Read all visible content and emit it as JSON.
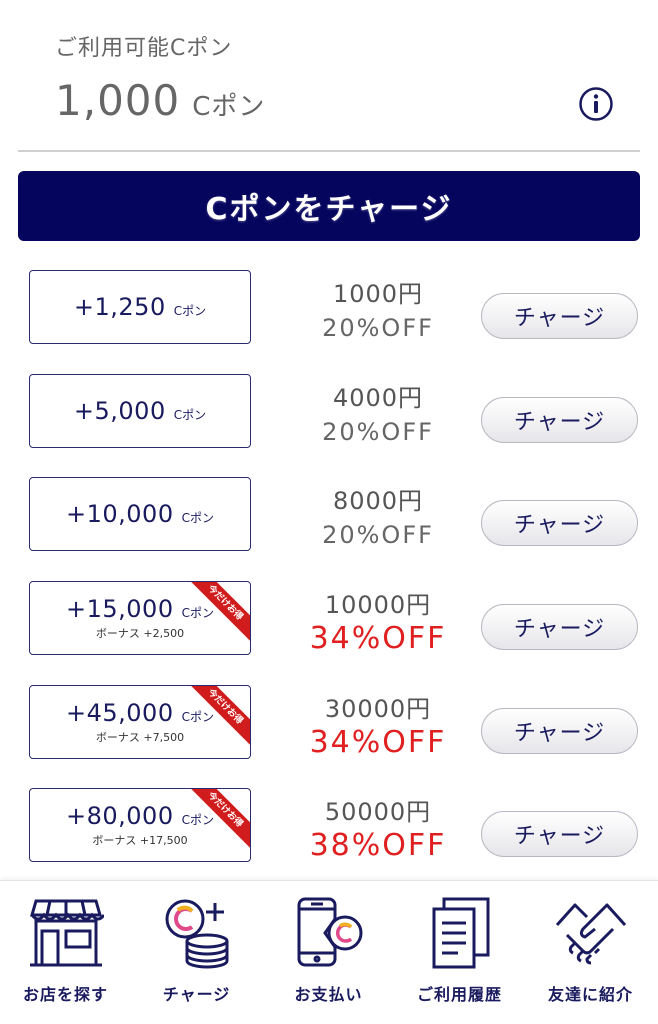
{
  "balance": {
    "label": "ご利用可能Cポン",
    "amount": "1,000",
    "unit": "Cポン"
  },
  "header": {
    "title": "Cポンをチャージ"
  },
  "plans": [
    {
      "amount": "+1,250",
      "unit": "Cポン",
      "bonus": "",
      "ribbon": "",
      "price": "1000円",
      "discount": "20%OFF",
      "button": "チャージ"
    },
    {
      "amount": "+5,000",
      "unit": "Cポン",
      "bonus": "",
      "ribbon": "",
      "price": "4000円",
      "discount": "20%OFF",
      "button": "チャージ"
    },
    {
      "amount": "+10,000",
      "unit": "Cポン",
      "bonus": "",
      "ribbon": "",
      "price": "8000円",
      "discount": "20%OFF",
      "button": "チャージ"
    },
    {
      "amount": "+15,000",
      "unit": "Cポン",
      "bonus": "ボーナス +2,500",
      "ribbon": "今だけお得",
      "price": "10000円",
      "discount": "34%OFF",
      "button": "チャージ"
    },
    {
      "amount": "+45,000",
      "unit": "Cポン",
      "bonus": "ボーナス +7,500",
      "ribbon": "今だけお得",
      "price": "30000円",
      "discount": "34%OFF",
      "button": "チャージ"
    },
    {
      "amount": "+80,000",
      "unit": "Cポン",
      "bonus": "ボーナス +17,500",
      "ribbon": "今だけお得",
      "price": "50000円",
      "discount": "38%OFF",
      "button": "チャージ"
    }
  ],
  "tabs": [
    {
      "label": "お店を探す",
      "icon": "store-icon"
    },
    {
      "label": "チャージ",
      "icon": "coin-charge-icon"
    },
    {
      "label": "お支払い",
      "icon": "phone-pay-icon"
    },
    {
      "label": "ご利用履歴",
      "icon": "history-document-icon"
    },
    {
      "label": "友達に紹介",
      "icon": "handshake-icon"
    }
  ],
  "colors": {
    "navy": "#05055e",
    "text": "#1a1a5e",
    "accent_red": "#e02020",
    "ribbon_red": "#d01c1c"
  }
}
